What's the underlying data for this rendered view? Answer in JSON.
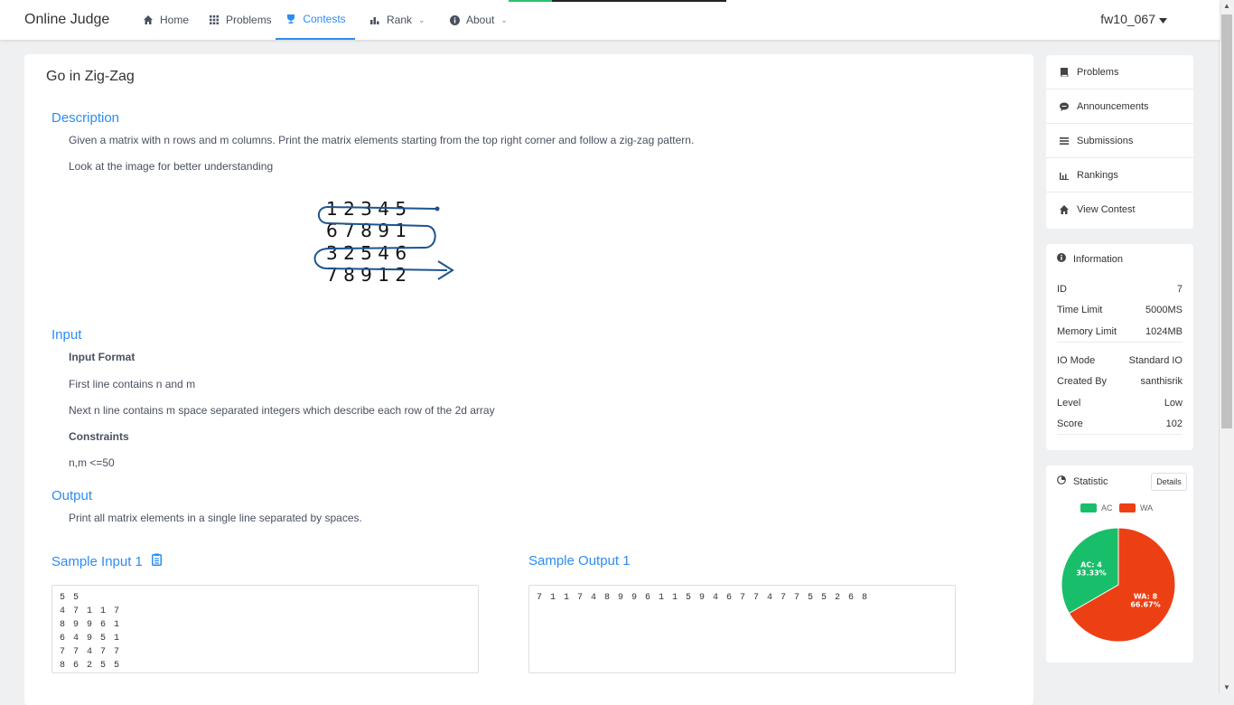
{
  "navbar": {
    "brand": "Online Judge",
    "items": [
      {
        "label": "Home",
        "icon": "home-icon"
      },
      {
        "label": "Problems",
        "icon": "grid-icon"
      },
      {
        "label": "Contests",
        "icon": "trophy-icon"
      },
      {
        "label": "Rank",
        "icon": "bar-chart-icon"
      },
      {
        "label": "About",
        "icon": "info-icon"
      }
    ],
    "active": "Contests",
    "user": "fw10_067"
  },
  "loading_progress": 0.2,
  "problem": {
    "title": "Go in Zig-Zag",
    "description_title": "Description",
    "description": [
      "Given a matrix with n rows and m columns. Print the matrix elements starting from the top right corner and follow a zig-zag pattern.",
      "Look at the image for better understanding"
    ],
    "image_rows": [
      "1 2 3 4 5",
      "6 7 8 9 1",
      "3 2 5 4 6",
      "7 8 9 1 2"
    ],
    "input_title": "Input",
    "input_format_label": "Input Format",
    "input_lines": [
      "First line contains n and m",
      "Next n line contains m space separated integers which describe each row of the 2d array"
    ],
    "constraints_label": "Constraints",
    "constraints": "n,m <=50",
    "output_title": "Output",
    "output_text": "Print all matrix elements in a single line separated by spaces.",
    "sample_input_title": "Sample Input 1",
    "sample_input": "5 5\n4 7 1 1 7\n8 9 9 6 1\n6 4 9 5 1\n7 7 4 7 7\n8 6 2 5 5",
    "sample_output_title": "Sample Output 1",
    "sample_output": "7 1 1 7 4 8 9 9 6 1 1 5 9 4 6 7 7 4 7 7 5 5 2 6 8"
  },
  "sidebar": {
    "menu": [
      {
        "label": "Problems",
        "icon": "book-icon"
      },
      {
        "label": "Announcements",
        "icon": "chat-icon"
      },
      {
        "label": "Submissions",
        "icon": "list-icon"
      },
      {
        "label": "Rankings",
        "icon": "bar-chart-icon"
      },
      {
        "label": "View Contest",
        "icon": "home-icon"
      }
    ],
    "info": {
      "title": "Information",
      "rows": [
        {
          "k": "ID",
          "v": "7"
        },
        {
          "k": "Time Limit",
          "v": "5000MS"
        },
        {
          "k": "Memory Limit",
          "v": "1024MB"
        },
        {
          "k": "IO Mode",
          "v": "Standard IO"
        },
        {
          "k": "Created By",
          "v": "santhisrik"
        },
        {
          "k": "Level",
          "v": "Low"
        },
        {
          "k": "Score",
          "v": "102"
        }
      ]
    },
    "statistic": {
      "title": "Statistic",
      "details": "Details",
      "colors": {
        "AC": "#19be6b",
        "WA": "#ed3f14"
      }
    }
  },
  "chart_data": {
    "type": "pie",
    "categories": [
      "AC",
      "WA"
    ],
    "values": [
      4,
      8
    ],
    "labels": [
      [
        "AC: 4",
        "33.33%"
      ],
      [
        "WA: 8",
        "66.67%"
      ]
    ],
    "legend": "top"
  }
}
